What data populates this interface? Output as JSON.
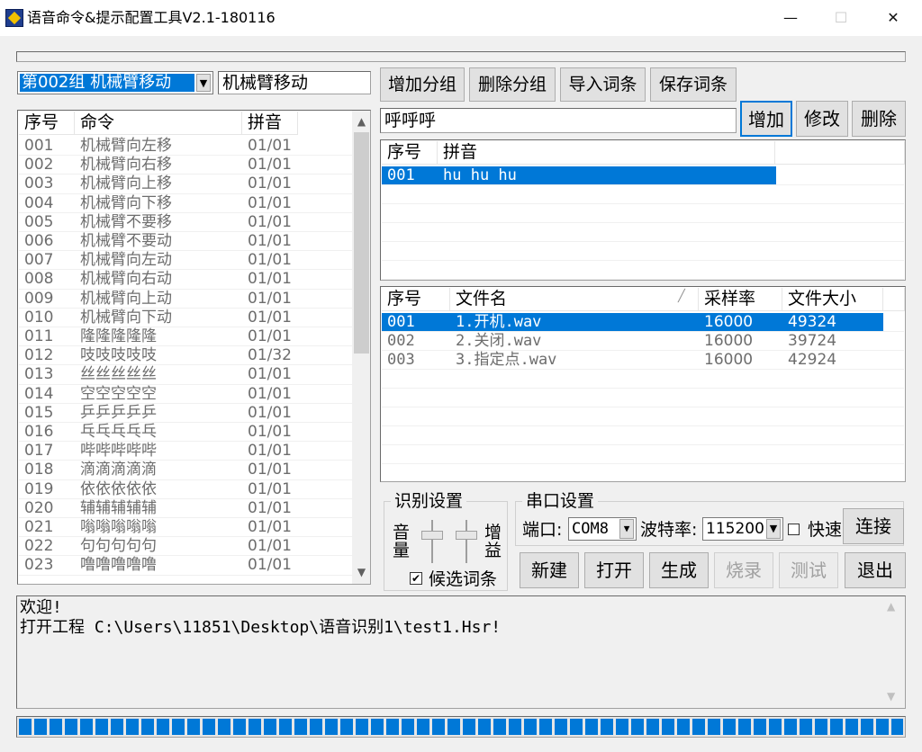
{
  "window": {
    "title": "语音命令&提示配置工具V2.1-180116",
    "minimize": "—",
    "maximize": "☐",
    "close": "✕"
  },
  "group": {
    "selected": "第002组 机械臂移动",
    "name_value": "机械臂移动"
  },
  "toolbar": {
    "add_group": "增加分组",
    "delete_group": "删除分组",
    "import_entries": "导入词条",
    "save_entries": "保存词条"
  },
  "command_list": {
    "headers": [
      "序号",
      "命令",
      "拼音"
    ],
    "rows": [
      [
        "001",
        "机械臂向左移",
        "01/01"
      ],
      [
        "002",
        "机械臂向右移",
        "01/01"
      ],
      [
        "003",
        "机械臂向上移",
        "01/01"
      ],
      [
        "004",
        "机械臂向下移",
        "01/01"
      ],
      [
        "005",
        "机械臂不要移",
        "01/01"
      ],
      [
        "006",
        "机械臂不要动",
        "01/01"
      ],
      [
        "007",
        "机械臂向左动",
        "01/01"
      ],
      [
        "008",
        "机械臂向右动",
        "01/01"
      ],
      [
        "009",
        "机械臂向上动",
        "01/01"
      ],
      [
        "010",
        "机械臂向下动",
        "01/01"
      ],
      [
        "011",
        "隆隆隆隆隆",
        "01/01"
      ],
      [
        "012",
        "吱吱吱吱吱",
        "01/32"
      ],
      [
        "013",
        "丝丝丝丝丝",
        "01/01"
      ],
      [
        "014",
        "空空空空空",
        "01/01"
      ],
      [
        "015",
        "乒乒乒乒乒",
        "01/01"
      ],
      [
        "016",
        "乓乓乓乓乓",
        "01/01"
      ],
      [
        "017",
        "哔哔哔哔哔",
        "01/01"
      ],
      [
        "018",
        "滴滴滴滴滴",
        "01/01"
      ],
      [
        "019",
        "依依依依依",
        "01/01"
      ],
      [
        "020",
        "辅辅辅辅辅",
        "01/01"
      ],
      [
        "021",
        "嗡嗡嗡嗡嗡",
        "01/01"
      ],
      [
        "022",
        "句句句句句",
        "01/01"
      ],
      [
        "023",
        "噜噜噜噜噜",
        "01/01"
      ]
    ]
  },
  "entry": {
    "value": "呼呼呼",
    "add": "增加",
    "modify": "修改",
    "delete": "删除"
  },
  "pinyin_list": {
    "headers": [
      "序号",
      "拼音"
    ],
    "rows": [
      [
        "001",
        "hu hu hu"
      ]
    ]
  },
  "file_list": {
    "headers": [
      "序号",
      "文件名",
      "采样率",
      "文件大小"
    ],
    "rows": [
      [
        "001",
        "1.开机.wav",
        "16000",
        "49324"
      ],
      [
        "002",
        "2.关闭.wav",
        "16000",
        "39724"
      ],
      [
        "003",
        "3.指定点.wav",
        "16000",
        "42924"
      ]
    ]
  },
  "recognition": {
    "title": "识别设置",
    "volume": "音量",
    "gain": "增益",
    "candidates": "候选词条",
    "candidates_checked": true
  },
  "serial": {
    "title": "串口设置",
    "port_label": "端口:",
    "port_value": "COM8",
    "baud_label": "波特率:",
    "baud_value": "115200",
    "fast_label": "快速",
    "connect": "连接"
  },
  "actions": {
    "new": "新建",
    "open": "打开",
    "generate": "生成",
    "burn": "烧录",
    "test": "测试",
    "exit": "退出"
  },
  "log": {
    "line1": "欢迎!",
    "line2": "打开工程 C:\\Users\\11851\\Desktop\\语音识别1\\test1.Hsr!"
  },
  "progress": {
    "fraction": 1.0
  },
  "colors": {
    "selection": "#0078d7",
    "window_bg": "#f0f0f0"
  }
}
